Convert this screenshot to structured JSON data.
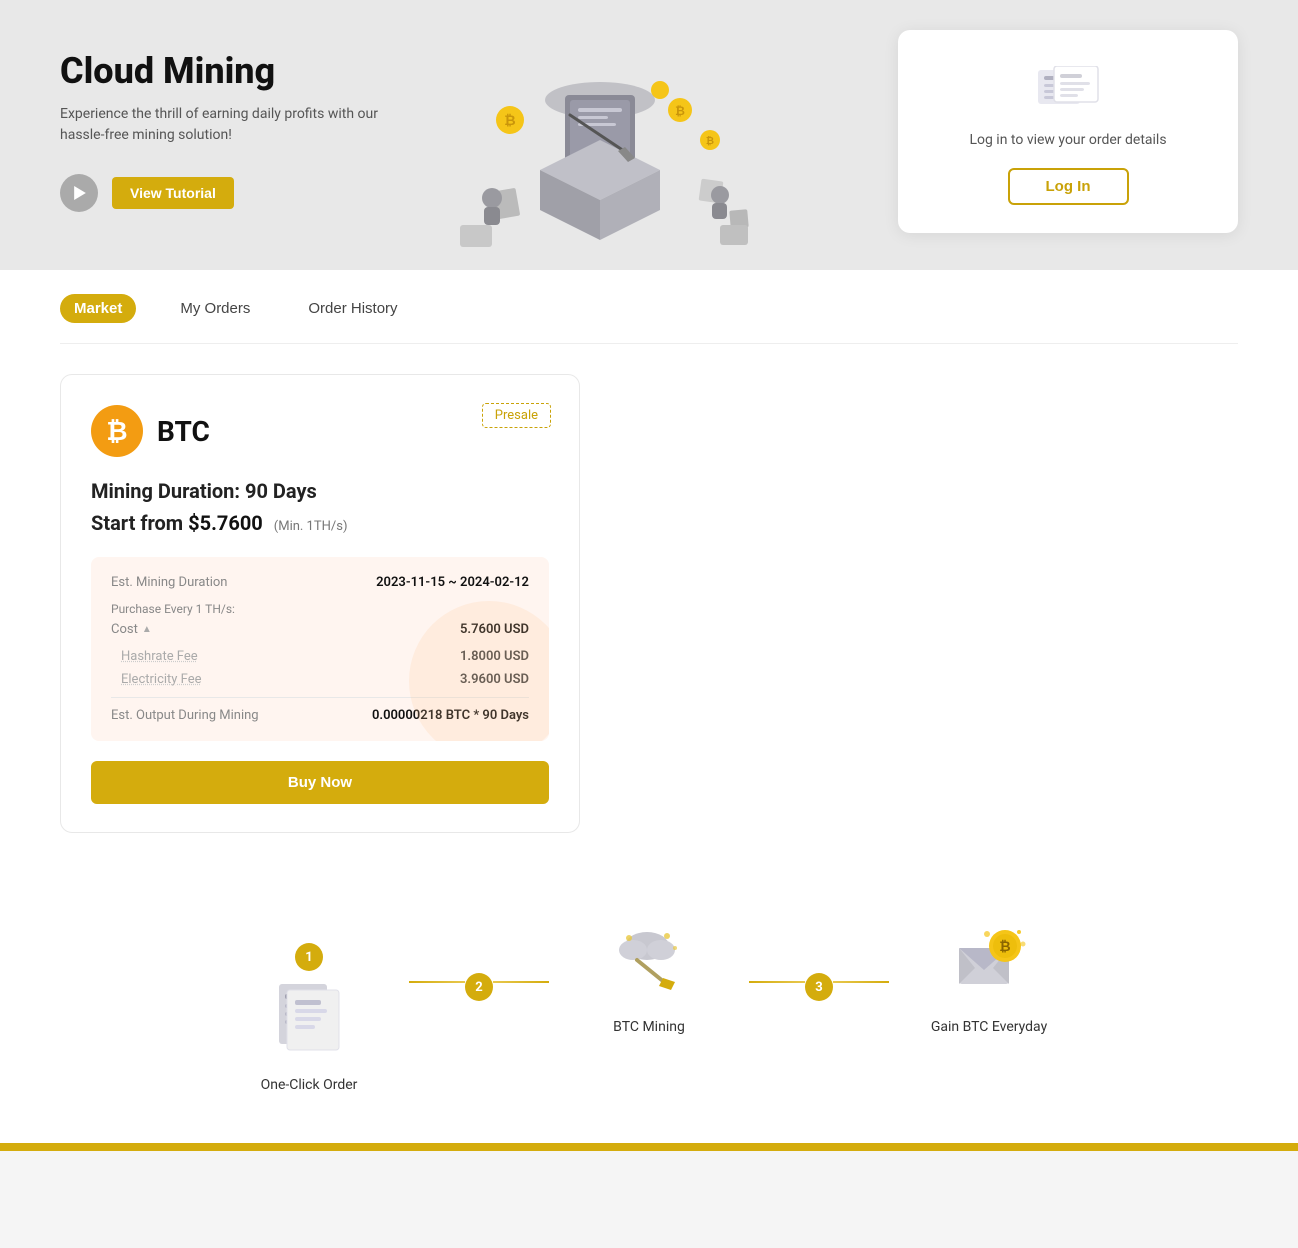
{
  "hero": {
    "title": "Cloud Mining",
    "subtitle": "Experience the thrill of earning daily profits with our hassle-free mining solution!",
    "tutorial_label": "View Tutorial",
    "login_card": {
      "text": "Log in to view your order details",
      "login_label": "Log In"
    }
  },
  "tabs": [
    {
      "label": "Market",
      "active": true
    },
    {
      "label": "My Orders",
      "active": false
    },
    {
      "label": "Order History",
      "active": false
    }
  ],
  "product": {
    "coin": "BTC",
    "presale": "Presale",
    "mining_duration_label": "Mining Duration:",
    "mining_duration_value": "90 Days",
    "start_from_label": "Start from",
    "start_from_price": "$5.7600",
    "start_from_min": "(Min. 1TH/s)",
    "details": {
      "est_mining_duration_label": "Est. Mining Duration",
      "est_mining_duration_value": "2023-11-15 ~ 2024-02-12",
      "purchase_label": "Purchase Every 1 TH/s:",
      "cost_label": "Cost",
      "cost_value": "5.7600 USD",
      "hashrate_fee_label": "Hashrate Fee",
      "hashrate_fee_value": "1.8000 USD",
      "electricity_fee_label": "Electricity Fee",
      "electricity_fee_value": "3.9600 USD",
      "est_output_label": "Est. Output During Mining",
      "est_output_value": "0.00000218 BTC * 90 Days"
    },
    "buy_label": "Buy Now"
  },
  "steps": [
    {
      "number": "1",
      "label": "One-Click Order"
    },
    {
      "number": "2",
      "label": "BTC Mining"
    },
    {
      "number": "3",
      "label": "Gain BTC Everyday"
    }
  ]
}
